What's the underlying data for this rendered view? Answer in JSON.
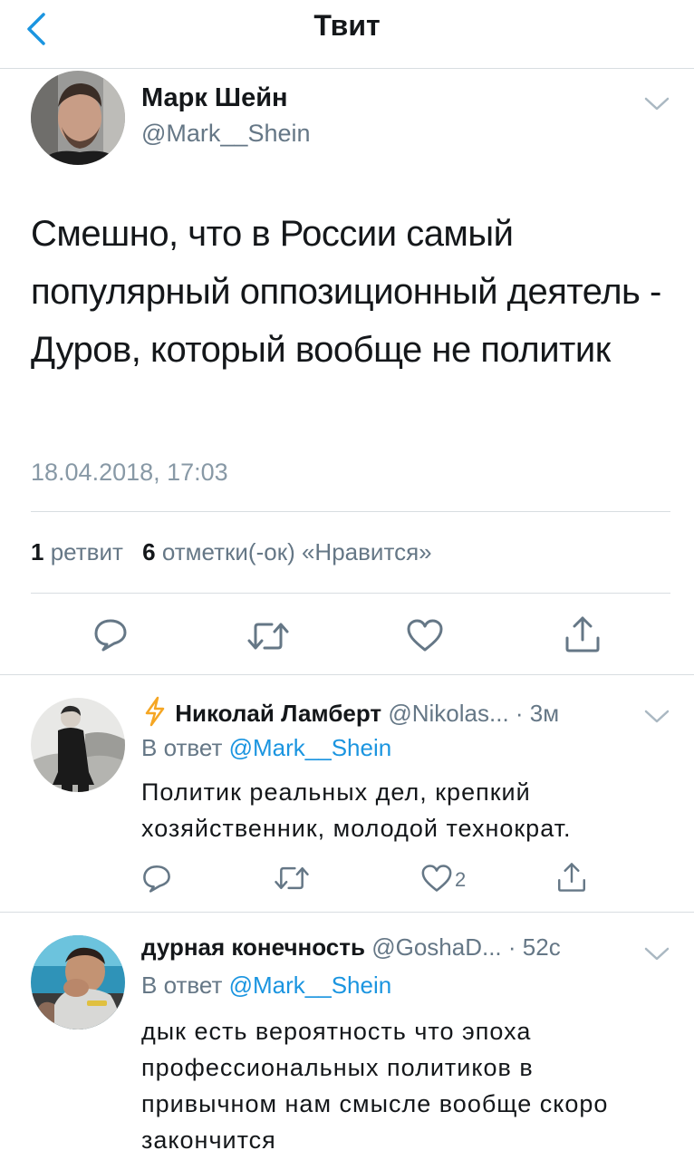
{
  "nav": {
    "title": "Твит",
    "back_icon": "chevron-left-icon"
  },
  "main_tweet": {
    "author_name": "Марк Шейн",
    "author_handle": "@Mark__Shein",
    "text": "Смешно, что в России самый популярный оппозиционный деятель - Дуров, который вообще не политик",
    "timestamp": "18.04.2018, 17:03",
    "retweet_count": "1",
    "retweet_label": "ретвит",
    "like_count": "6",
    "like_label": "отметки(-ок) «Нравится»",
    "actions": [
      "reply-icon",
      "retweet-icon",
      "like-icon",
      "share-icon"
    ]
  },
  "replies": [
    {
      "author_name": "Николай Ламберт",
      "author_handle": "@Nikolas...",
      "time": "· 3м",
      "badge_icon": "lightning-icon",
      "reply_prefix": "В ответ",
      "reply_to": "@Mark__Shein",
      "text": "Политик реальных дел, крепкий хозяйственник, молодой технократ.",
      "like_count": "2"
    },
    {
      "author_name": "дурная конечность",
      "author_handle": "@GoshaD...",
      "time": "· 52с",
      "reply_prefix": "В ответ",
      "reply_to": "@Mark__Shein",
      "text": "дык есть вероятность что эпоха профессиональных политиков в привычном нам смысле вообще скоро закончится"
    }
  ],
  "colors": {
    "accent": "#1b95e0",
    "text": "#14171a",
    "secondary": "#657786",
    "divider": "#d8dde1",
    "lightning": "#f5a623"
  }
}
